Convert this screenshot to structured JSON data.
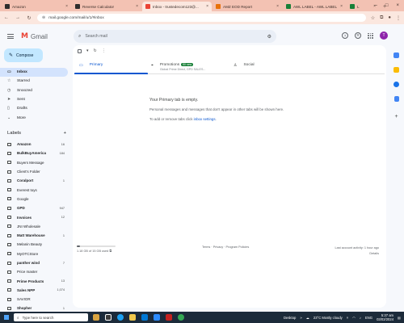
{
  "browser": {
    "tabs": [
      {
        "label": "Amazon",
        "color": "#2d2d2d",
        "active": false
      },
      {
        "label": "Reverse Calculator",
        "color": "#2d2d2d",
        "active": false
      },
      {
        "label": "Inbox - trustedecom123@...",
        "color": "#ea4335",
        "active": true
      },
      {
        "label": "AMZ EOD Report",
        "color": "#e8710a",
        "active": false
      },
      {
        "label": "AWL LABEL - AWL LABEL",
        "color": "#188038",
        "active": false
      },
      {
        "label": "L",
        "color": "#188038",
        "active": false
      }
    ],
    "new_tab": "+",
    "url": "mail.google.com/mail/u/1/#inbox"
  },
  "gmail": {
    "logo_text": "Gmail",
    "search_placeholder": "Search mail",
    "avatar_letter": "T",
    "compose_label": "Compose",
    "nav": [
      {
        "label": "Inbox",
        "icon": "inbox-icon",
        "active": true
      },
      {
        "label": "Starred",
        "icon": "star-icon"
      },
      {
        "label": "Snoozed",
        "icon": "clock-icon"
      },
      {
        "label": "Sent",
        "icon": "send-icon"
      },
      {
        "label": "Drafts",
        "icon": "draft-icon"
      },
      {
        "label": "More",
        "icon": "chevron-down-icon"
      }
    ],
    "labels_heading": "Labels",
    "labels_add": "+",
    "labels": [
      {
        "name": "Amazon",
        "count": "16",
        "bold": true
      },
      {
        "name": "BulkBuyAmerica",
        "count": "184",
        "bold": true
      },
      {
        "name": "Buyers Message",
        "count": "",
        "bold": false
      },
      {
        "name": "Client's Folder",
        "count": "",
        "bold": false
      },
      {
        "name": "Coralport",
        "count": "1",
        "bold": true
      },
      {
        "name": "Everest toys",
        "count": "",
        "bold": false
      },
      {
        "name": "Google",
        "count": "",
        "bold": false
      },
      {
        "name": "GPD",
        "count": "947",
        "bold": true
      },
      {
        "name": "Invoices",
        "count": "12",
        "bold": true
      },
      {
        "name": "JNI Wholesale",
        "count": "",
        "bold": false
      },
      {
        "name": "Matt Warehouse",
        "count": "1",
        "bold": true
      },
      {
        "name": "Melanin Beauty",
        "count": "",
        "bold": false
      },
      {
        "name": "MyOTCStore",
        "count": "",
        "bold": false
      },
      {
        "name": "panther wind",
        "count": "7",
        "bold": true
      },
      {
        "name": "Price master",
        "count": "",
        "bold": false
      },
      {
        "name": "Prime Products",
        "count": "13",
        "bold": true
      },
      {
        "name": "Sales NPP",
        "count": "1,074",
        "bold": true
      },
      {
        "name": "SAVIOR",
        "count": "",
        "bold": false
      },
      {
        "name": "Shopher",
        "count": "1",
        "bold": true
      }
    ],
    "tabs": [
      {
        "label": "Primary",
        "sub": "",
        "badge": "",
        "active": true
      },
      {
        "label": "Promotions",
        "sub": "Global Prime Direct, GPD SALES...",
        "badge": "50 new",
        "active": false
      },
      {
        "label": "Social",
        "sub": "",
        "badge": "",
        "active": false
      }
    ],
    "empty": {
      "line1": "Your Primary tab is empty.",
      "line2": "Personal messages and messages that don't appear in other tabs will be shown here.",
      "line3_prefix": "To add or remove tabs click ",
      "line3_link": "inbox settings",
      "line3_suffix": "."
    },
    "footer": {
      "storage_text": "1.18 GB of 15 GB used",
      "storage_fraction": 0.08,
      "links": "Terms · Privacy · Program Policies",
      "activity": "Last account activity: 1 hour ago",
      "details": "Details"
    }
  },
  "taskbar": {
    "search_placeholder": "Type here to search",
    "desktop_label": "Desktop",
    "weather": "23°C  Mostly cloudy",
    "lang": "ENG",
    "time": "5:37 am",
    "date": "03/02/2024"
  }
}
